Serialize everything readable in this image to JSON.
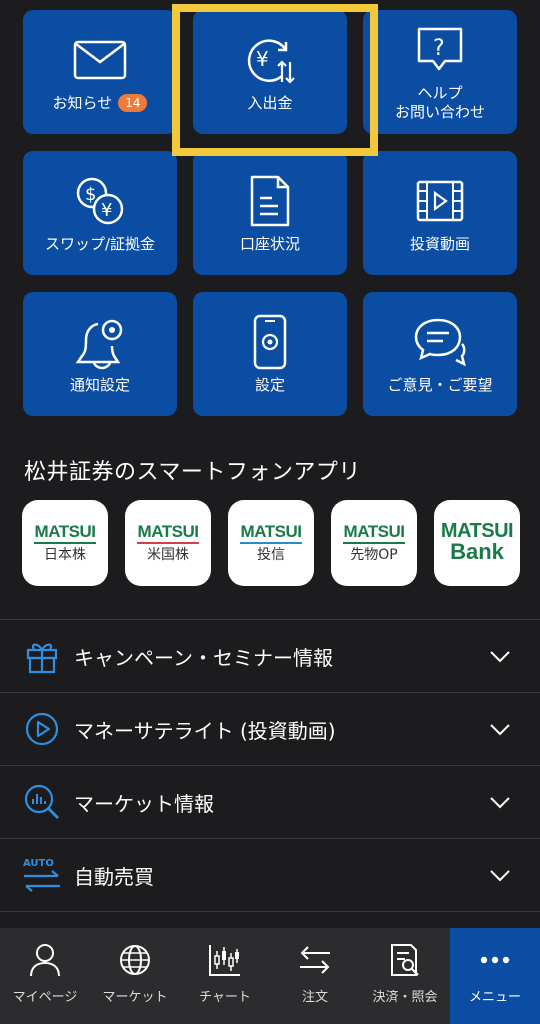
{
  "tiles": [
    {
      "label": "お知らせ",
      "badge": "14",
      "icon": "mail-icon"
    },
    {
      "label": "入出金",
      "icon": "yen-transfer-icon"
    },
    {
      "label": "ヘルプ\nお問い合わせ",
      "icon": "help-icon"
    },
    {
      "label": "スワップ/証拠金",
      "icon": "swap-currency-icon"
    },
    {
      "label": "口座状況",
      "icon": "document-icon"
    },
    {
      "label": "投資動画",
      "icon": "video-icon"
    },
    {
      "label": "通知設定",
      "icon": "bell-gear-icon"
    },
    {
      "label": "設定",
      "icon": "phone-settings-icon"
    },
    {
      "label": "ご意見・ご要望",
      "icon": "chat-bubbles-icon"
    }
  ],
  "apps_section": {
    "title": "松井証券のスマートフォンアプリ",
    "apps": [
      {
        "brand": "MATSUI",
        "sub": "日本株",
        "line_color": "#1b7a4a"
      },
      {
        "brand": "MATSUI",
        "sub": "米国株",
        "line_color": "#d0404a"
      },
      {
        "brand": "MATSUI",
        "sub": "投信",
        "line_color": "#2a8ad0"
      },
      {
        "brand": "MATSUI",
        "sub": "先物OP",
        "line_color": "#1b7a4a"
      },
      {
        "brand": "MATSUI",
        "sub": "Bank",
        "line_color": "#1b7a4a"
      }
    ]
  },
  "menu_rows": [
    {
      "label": "キャンペーン・セミナー情報",
      "icon": "gift-icon"
    },
    {
      "label": "マネーサテライト (投資動画)",
      "icon": "play-circle-icon"
    },
    {
      "label": "マーケット情報",
      "icon": "chart-search-icon"
    },
    {
      "label": "自動売買",
      "icon": "auto-trade-icon",
      "icon_text": "AUTO"
    }
  ],
  "tabbar": [
    {
      "label": "マイページ",
      "icon": "person-icon"
    },
    {
      "label": "マーケット",
      "icon": "globe-icon"
    },
    {
      "label": "チャート",
      "icon": "candlestick-icon"
    },
    {
      "label": "注文",
      "icon": "arrows-exchange-icon"
    },
    {
      "label": "決済・照会",
      "icon": "report-search-icon"
    },
    {
      "label": "メニュー",
      "icon": "more-dots-icon",
      "active": true
    }
  ],
  "colors": {
    "tile": "#0b4da2",
    "highlight": "#f2c93a",
    "badge": "#f07a3a",
    "background": "#1c1c1e"
  }
}
